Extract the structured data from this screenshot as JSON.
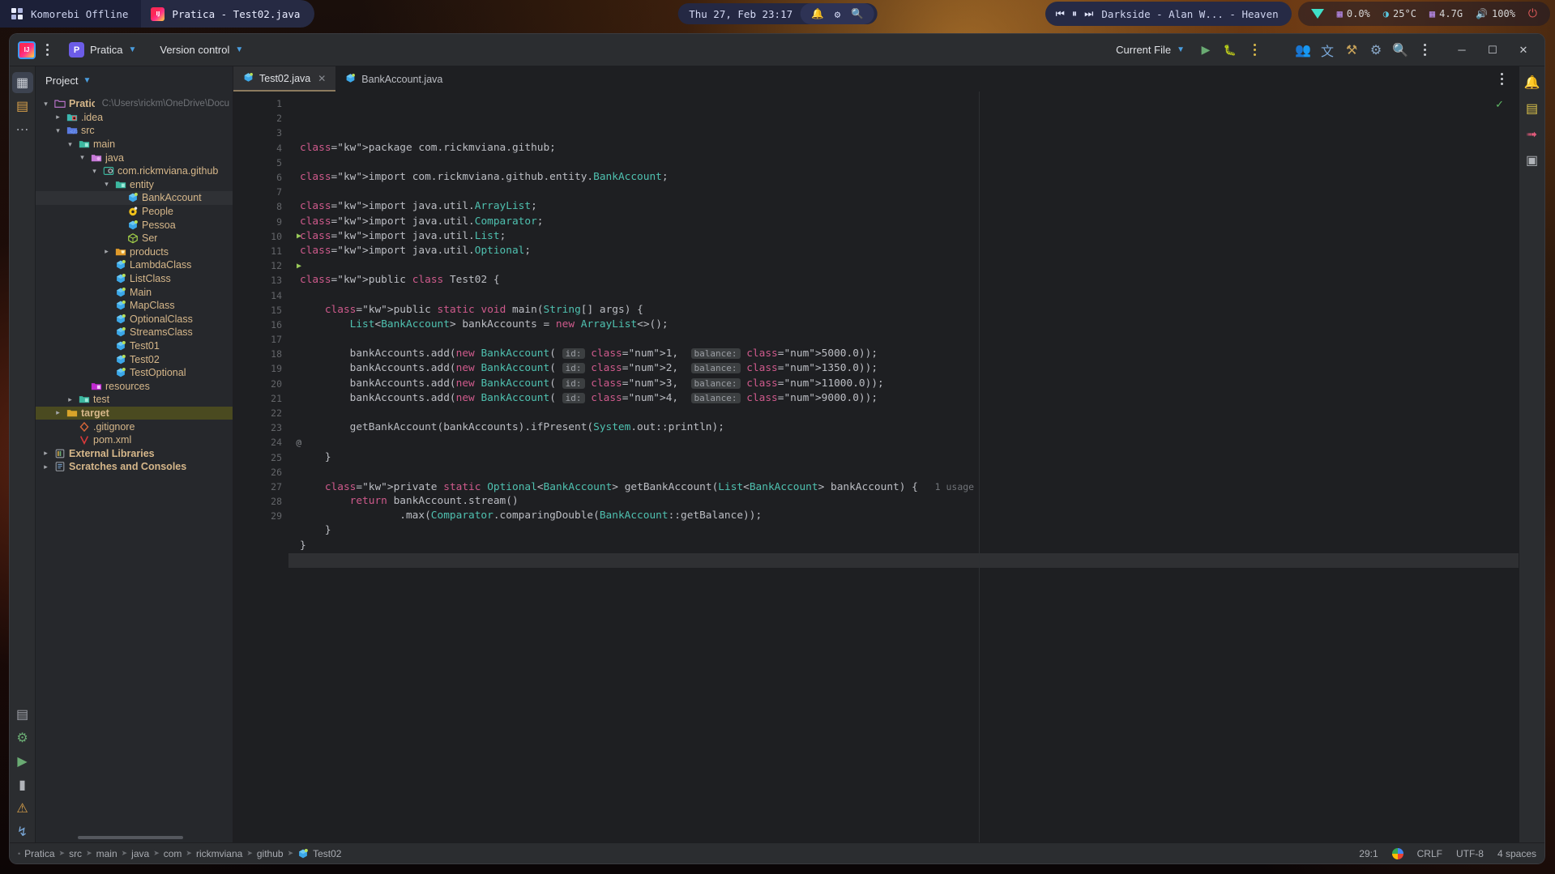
{
  "taskbar": {
    "workspace_label": "Komorebi Offline",
    "app_label": "Pratica - Test02.java",
    "clock": "Thu 27, Feb 23:17",
    "tray_icons": [
      "bell-icon",
      "gear-icon",
      "search-icon"
    ],
    "media": {
      "prev": "⏮",
      "pause": "⏸",
      "next": "⏭",
      "track": "Darkside - Alan W... - Heaven"
    },
    "system": [
      {
        "icon": "wifi-icon",
        "label": ""
      },
      {
        "icon": "cpu-icon",
        "label": "0.0%"
      },
      {
        "icon": "temperature-icon",
        "label": "25°C"
      },
      {
        "icon": "memory-icon",
        "label": "4.7G"
      },
      {
        "icon": "volume-icon",
        "label": "100%"
      },
      {
        "icon": "power-icon",
        "label": ""
      }
    ]
  },
  "header": {
    "project_badge": "P",
    "project_name": "Pratica",
    "version_control": "Version control",
    "run_config": "Current File",
    "run_icon": "run-icon",
    "debug_icon": "debug-icon",
    "more_icon": "more-vertical-icon",
    "right_icons": [
      "collaborate-icon",
      "translate-icon",
      "tools-icon",
      "inspect-icon",
      "search-icon",
      "more-vertical-icon"
    ],
    "minimize": "─",
    "maximize": "☐",
    "close": "✕"
  },
  "project": {
    "title": "Project",
    "tree": [
      {
        "indent": 0,
        "twisty": "down",
        "icon": "folder-module",
        "label": "Pratica",
        "path": "C:\\Users\\rickm\\OneDrive\\Docu",
        "state": ""
      },
      {
        "indent": 1,
        "twisty": "right",
        "icon": "folder-idea",
        "label": ".idea",
        "path": "",
        "state": ""
      },
      {
        "indent": 1,
        "twisty": "down",
        "icon": "folder-source",
        "label": "src",
        "path": "",
        "state": ""
      },
      {
        "indent": 2,
        "twisty": "down",
        "icon": "folder-main",
        "label": "main",
        "path": "",
        "state": ""
      },
      {
        "indent": 3,
        "twisty": "down",
        "icon": "folder-java",
        "label": "java",
        "path": "",
        "state": ""
      },
      {
        "indent": 4,
        "twisty": "down",
        "icon": "package-icon",
        "label": "com.rickmviana.github",
        "path": "",
        "state": ""
      },
      {
        "indent": 5,
        "twisty": "down",
        "icon": "folder-entity",
        "label": "entity",
        "path": "",
        "state": ""
      },
      {
        "indent": 6,
        "twisty": "",
        "icon": "class-icon",
        "label": "BankAccount",
        "path": "",
        "state": "selected"
      },
      {
        "indent": 6,
        "twisty": "",
        "icon": "interface-icon",
        "label": "People",
        "path": "",
        "state": ""
      },
      {
        "indent": 6,
        "twisty": "",
        "icon": "class-icon",
        "label": "Pessoa",
        "path": "",
        "state": ""
      },
      {
        "indent": 6,
        "twisty": "",
        "icon": "record-icon",
        "label": "Ser",
        "path": "",
        "state": ""
      },
      {
        "indent": 5,
        "twisty": "right",
        "icon": "folder-products",
        "label": "products",
        "path": "",
        "state": ""
      },
      {
        "indent": 5,
        "twisty": "",
        "icon": "class-icon",
        "label": "LambdaClass",
        "path": "",
        "state": ""
      },
      {
        "indent": 5,
        "twisty": "",
        "icon": "class-icon",
        "label": "ListClass",
        "path": "",
        "state": ""
      },
      {
        "indent": 5,
        "twisty": "",
        "icon": "class-icon",
        "label": "Main",
        "path": "",
        "state": ""
      },
      {
        "indent": 5,
        "twisty": "",
        "icon": "class-icon",
        "label": "MapClass",
        "path": "",
        "state": ""
      },
      {
        "indent": 5,
        "twisty": "",
        "icon": "class-icon",
        "label": "OptionalClass",
        "path": "",
        "state": ""
      },
      {
        "indent": 5,
        "twisty": "",
        "icon": "class-icon",
        "label": "StreamsClass",
        "path": "",
        "state": ""
      },
      {
        "indent": 5,
        "twisty": "",
        "icon": "class-icon",
        "label": "Test01",
        "path": "",
        "state": ""
      },
      {
        "indent": 5,
        "twisty": "",
        "icon": "class-icon",
        "label": "Test02",
        "path": "",
        "state": ""
      },
      {
        "indent": 5,
        "twisty": "",
        "icon": "class-icon",
        "label": "TestOptional",
        "path": "",
        "state": ""
      },
      {
        "indent": 3,
        "twisty": "",
        "icon": "folder-resources",
        "label": "resources",
        "path": "",
        "state": ""
      },
      {
        "indent": 2,
        "twisty": "right",
        "icon": "folder-test",
        "label": "test",
        "path": "",
        "state": ""
      },
      {
        "indent": 1,
        "twisty": "right",
        "icon": "folder-target",
        "label": "target",
        "path": "",
        "state": "olive"
      },
      {
        "indent": 2,
        "twisty": "",
        "icon": "gitignore-icon",
        "label": ".gitignore",
        "path": "",
        "state": ""
      },
      {
        "indent": 2,
        "twisty": "",
        "icon": "maven-icon",
        "label": "pom.xml",
        "path": "",
        "state": ""
      },
      {
        "indent": 0,
        "twisty": "right",
        "icon": "library-icon",
        "label": "External Libraries",
        "path": "",
        "state": ""
      },
      {
        "indent": 0,
        "twisty": "right",
        "icon": "scratch-icon",
        "label": "Scratches and Consoles",
        "path": "",
        "state": ""
      }
    ]
  },
  "editor": {
    "tabs": [
      {
        "icon": "class-icon",
        "label": "Test02.java",
        "active": true,
        "closable": true
      },
      {
        "icon": "class-icon",
        "label": "BankAccount.java",
        "active": false,
        "closable": false
      }
    ],
    "inspection_status": "✓",
    "current_line": 29,
    "lines": [
      {
        "n": 1,
        "marker": "",
        "text": "package com.rickmviana.github;"
      },
      {
        "n": 2,
        "marker": "",
        "text": ""
      },
      {
        "n": 3,
        "marker": "",
        "text": "import com.rickmviana.github.entity.BankAccount;"
      },
      {
        "n": 4,
        "marker": "",
        "text": ""
      },
      {
        "n": 5,
        "marker": "",
        "text": "import java.util.ArrayList;"
      },
      {
        "n": 6,
        "marker": "",
        "text": "import java.util.Comparator;"
      },
      {
        "n": 7,
        "marker": "",
        "text": "import java.util.List;"
      },
      {
        "n": 8,
        "marker": "",
        "text": "import java.util.Optional;"
      },
      {
        "n": 9,
        "marker": "",
        "text": ""
      },
      {
        "n": 10,
        "marker": "run",
        "text": "public class Test02 {"
      },
      {
        "n": 11,
        "marker": "",
        "text": ""
      },
      {
        "n": 12,
        "marker": "run",
        "text": "    public static void main(String[] args) {"
      },
      {
        "n": 13,
        "marker": "",
        "text": "        List<BankAccount> bankAccounts = new ArrayList<>();"
      },
      {
        "n": 14,
        "marker": "",
        "text": ""
      },
      {
        "n": 15,
        "marker": "",
        "text": "        bankAccounts.add(new BankAccount( id: 1,  balance: 5000.0));"
      },
      {
        "n": 16,
        "marker": "",
        "text": "        bankAccounts.add(new BankAccount( id: 2,  balance: 1350.0));"
      },
      {
        "n": 17,
        "marker": "",
        "text": "        bankAccounts.add(new BankAccount( id: 3,  balance: 11000.0));"
      },
      {
        "n": 18,
        "marker": "",
        "text": "        bankAccounts.add(new BankAccount( id: 4,  balance: 9000.0));"
      },
      {
        "n": 19,
        "marker": "",
        "text": ""
      },
      {
        "n": 20,
        "marker": "",
        "text": "        getBankAccount(bankAccounts).ifPresent(System.out::println);"
      },
      {
        "n": 21,
        "marker": "",
        "text": ""
      },
      {
        "n": 22,
        "marker": "",
        "text": "    }"
      },
      {
        "n": 23,
        "marker": "",
        "text": ""
      },
      {
        "n": 24,
        "marker": "at",
        "text": "    private static Optional<BankAccount> getBankAccount(List<BankAccount> bankAccount) {   1 usage"
      },
      {
        "n": 25,
        "marker": "",
        "text": "        return bankAccount.stream()"
      },
      {
        "n": 26,
        "marker": "",
        "text": "                .max(Comparator.comparingDouble(BankAccount::getBalance));"
      },
      {
        "n": 27,
        "marker": "",
        "text": "    }"
      },
      {
        "n": 28,
        "marker": "",
        "text": "}"
      },
      {
        "n": 29,
        "marker": "",
        "text": ""
      }
    ],
    "usage_hint": "1 usage"
  },
  "statusbar": {
    "breadcrumbs": [
      "Pratica",
      "src",
      "main",
      "java",
      "com",
      "rickmviana",
      "github",
      "Test02"
    ],
    "last_crumb_icon": "class-icon",
    "caret": "29:1",
    "encoding_icon": "google-icon",
    "line_separator": "CRLF",
    "encoding": "UTF-8",
    "indent": "4 spaces"
  },
  "colors": {
    "ide_bg": "#1e1f22",
    "panel_bg": "#26282c",
    "header_bg": "#2b2d30",
    "accent_blue": "#4a9ee0",
    "keyword": "#cf5a8c",
    "type": "#4fc1b0",
    "selection": "#2f3135",
    "olive_highlight": "#4a4a20"
  }
}
